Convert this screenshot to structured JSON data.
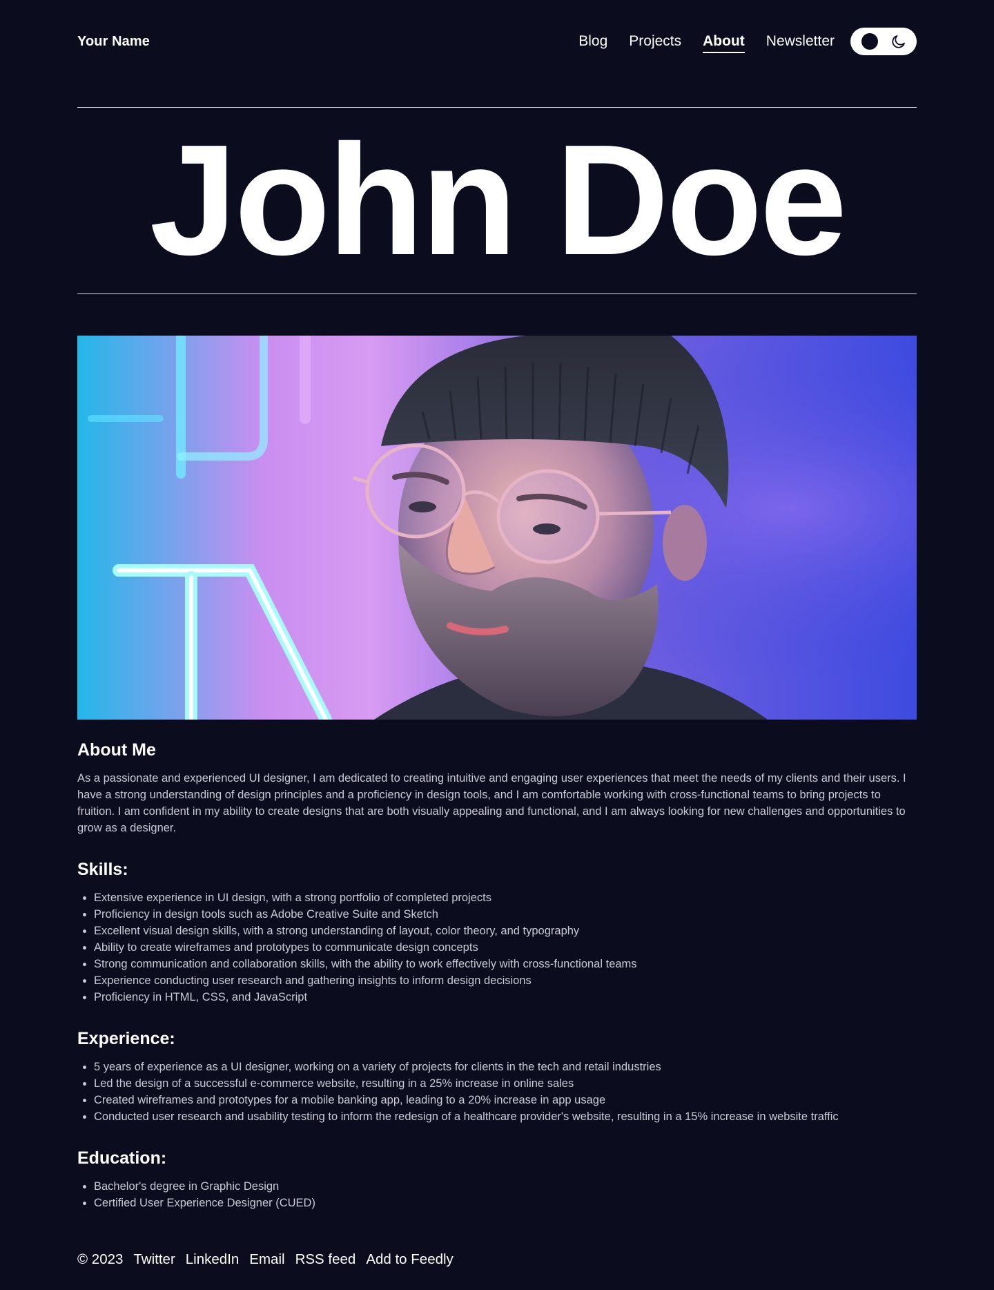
{
  "header": {
    "site_name": "Your Name",
    "nav": [
      {
        "label": "Blog",
        "active": false
      },
      {
        "label": "Projects",
        "active": false
      },
      {
        "label": "About",
        "active": true
      },
      {
        "label": "Newsletter",
        "active": false
      }
    ],
    "theme_toggle": {
      "icon": "moon-icon",
      "state": "dark"
    }
  },
  "hero": {
    "title": "John Doe"
  },
  "photo": {
    "subject": "portrait-photo"
  },
  "about": {
    "heading": "About Me",
    "text": "As a passionate and experienced UI designer, I am dedicated to creating intuitive and engaging user experiences that meet the needs of my clients and their users. I have a strong understanding of design principles and a proficiency in design tools, and I am comfortable working with cross-functional teams to bring projects to fruition. I am confident in my ability to create designs that are both visually appealing and functional, and I am always looking for new challenges and opportunities to grow as a designer."
  },
  "skills": {
    "heading": "Skills:",
    "items": [
      "Extensive experience in UI design, with a strong portfolio of completed projects",
      "Proficiency in design tools such as Adobe Creative Suite and Sketch",
      "Excellent visual design skills, with a strong understanding of layout, color theory, and typography",
      "Ability to create wireframes and prototypes to communicate design concepts",
      "Strong communication and collaboration skills, with the ability to work effectively with cross-functional teams",
      "Experience conducting user research and gathering insights to inform design decisions",
      "Proficiency in HTML, CSS, and JavaScript"
    ]
  },
  "experience": {
    "heading": "Experience:",
    "items": [
      "5 years of experience as a UI designer, working on a variety of projects for clients in the tech and retail industries",
      "Led the design of a successful e-commerce website, resulting in a 25% increase in online sales",
      "Created wireframes and prototypes for a mobile banking app, leading to a 20% increase in app usage",
      "Conducted user research and usability testing to inform the redesign of a healthcare provider's website, resulting in a 15% increase in website traffic"
    ]
  },
  "education": {
    "heading": "Education:",
    "items": [
      "Bachelor's degree in Graphic Design",
      "Certified User Experience Designer (CUED)"
    ]
  },
  "footer": {
    "copyright": "© 2023",
    "links": [
      "Twitter",
      "LinkedIn",
      "Email",
      "RSS feed",
      "Add to Feedly"
    ]
  },
  "colors": {
    "background": "#0b0d1f",
    "text": "#ffffff",
    "body_text": "#c9cad6"
  }
}
